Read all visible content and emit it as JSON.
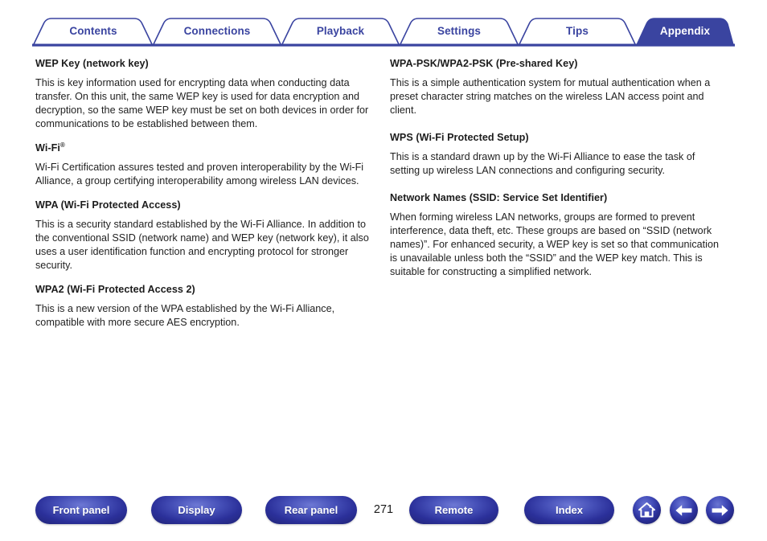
{
  "theme": {
    "accent_blue": "#3a44a0",
    "active_tab_fill": "#3a44a0",
    "text_color": "#1f1f1f",
    "page_background": "#ffffff"
  },
  "tabs": [
    {
      "label": "Contents",
      "active": false
    },
    {
      "label": "Connections",
      "active": false
    },
    {
      "label": "Playback",
      "active": false
    },
    {
      "label": "Settings",
      "active": false
    },
    {
      "label": "Tips",
      "active": false
    },
    {
      "label": "Appendix",
      "active": true
    }
  ],
  "content": {
    "left_column": [
      {
        "heading": "WEP Key (network key)",
        "body": "This is key information used for encrypting data when conducting data transfer. On this unit, the same WEP key is used for data encryption and decryption, so the same WEP key must be set on both devices in order for communications to be established between them."
      },
      {
        "heading": "Wi-Fi",
        "heading_superscript": "®",
        "body": "Wi-Fi Certification assures tested and proven interoperability by the Wi-Fi Alliance, a group certifying interoperability among wireless LAN devices."
      },
      {
        "heading": "WPA (Wi-Fi Protected Access)",
        "body": "This is a security standard established by the Wi-Fi Alliance. In addition to the conventional SSID (network name) and WEP key (network key), it also uses a user identification function and encrypting protocol for stronger security."
      },
      {
        "heading": "WPA2 (Wi-Fi Protected Access 2)",
        "body": "This is a new version of the WPA established by the Wi-Fi Alliance, compatible with more secure AES encryption."
      }
    ],
    "right_column": [
      {
        "heading": "WPA-PSK/WPA2-PSK (Pre-shared Key)",
        "body": "This is a simple authentication system for mutual authentication when a preset character string matches on the wireless LAN access point and client."
      },
      {
        "heading": "WPS (Wi-Fi Protected Setup)",
        "body": "This is a standard drawn up by the Wi-Fi Alliance to ease the task of setting up wireless LAN connections and configuring security."
      },
      {
        "heading": "Network Names (SSID: Service Set Identifier)",
        "body": "When forming wireless LAN networks, groups are formed to prevent interference, data theft, etc. These groups are based on “SSID (network names)”. For enhanced security, a WEP key is set so that communication is unavailable unless both the “SSID” and the WEP key match. This is suitable for constructing a simplified network."
      }
    ]
  },
  "footer": {
    "buttons": [
      {
        "label": "Front panel"
      },
      {
        "label": "Display"
      },
      {
        "label": "Rear panel"
      },
      {
        "label": "Remote"
      },
      {
        "label": "Index"
      }
    ],
    "page_number": "271",
    "icon_buttons": [
      {
        "icon": "home-icon"
      },
      {
        "icon": "arrow-left-icon"
      },
      {
        "icon": "arrow-right-icon"
      }
    ]
  }
}
